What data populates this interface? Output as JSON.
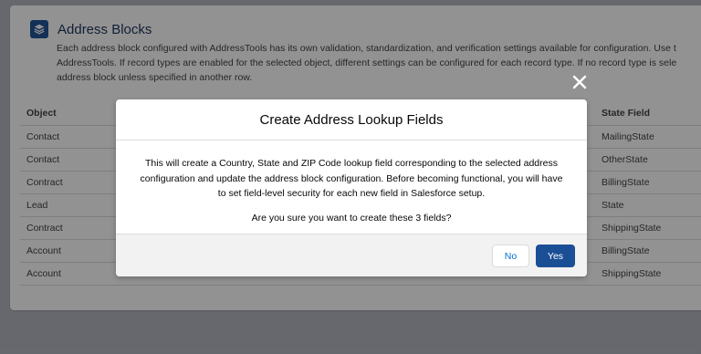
{
  "page": {
    "title": "Address Blocks",
    "icon": "address-block-icon",
    "description_lines": [
      "Each address block configured with AddressTools has its own validation, standardization, and verification settings available for configuration. Use t",
      "AddressTools. If record types are enabled for the selected object, different settings can be configured for each record type. If no record type is sele",
      "address block unless specified in another row."
    ]
  },
  "table": {
    "columns": {
      "object": "Object",
      "state_field": "State Field"
    },
    "rows": [
      {
        "object": "Contact",
        "state_field": "MailingState"
      },
      {
        "object": "Contact",
        "state_field": "OtherState"
      },
      {
        "object": "Contract",
        "state_field": "BillingState"
      },
      {
        "object": "Lead",
        "state_field": "State"
      },
      {
        "object": "Contract",
        "state_field": "ShippingState"
      },
      {
        "object": "Account",
        "state_field": "BillingState"
      },
      {
        "object": "Account",
        "state_field": "ShippingState"
      }
    ]
  },
  "modal": {
    "title": "Create Address Lookup Fields",
    "body_lines": [
      "This will create a Country, State and ZIP Code lookup field corresponding to the selected address",
      "configuration and update the address block configuration. Before becoming functional, you will have",
      "to set field-level security for each new field in Salesforce setup."
    ],
    "confirm_text": "Are you sure you want to create these 3 fields?",
    "no_label": "No",
    "yes_label": "Yes",
    "close_icon": "close-icon"
  },
  "colors": {
    "brand": "#1b4f95",
    "link": "#0070d2"
  }
}
